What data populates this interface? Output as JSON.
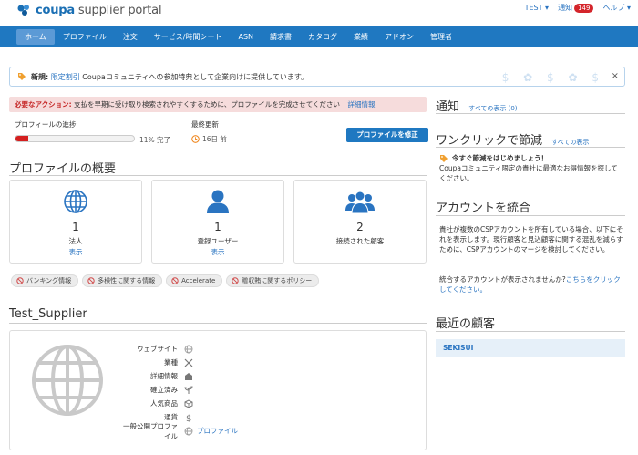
{
  "header": {
    "logo_bold": "coupa",
    "logo_rest": " supplier portal",
    "user": "TEST",
    "notifications_label": "通知",
    "notifications_count": "149",
    "help": "ヘルプ"
  },
  "nav": {
    "items": [
      "ホーム",
      "プロファイル",
      "注文",
      "サービス/時間シート",
      "ASN",
      "請求書",
      "カタログ",
      "業績",
      "アドオン",
      "管理者"
    ]
  },
  "announcement": {
    "prefix": "新規:",
    "link": "限定割引",
    "text": " Coupaコミュニティへの参加特典として企業向けに提供しています。",
    "close": "×"
  },
  "alert": {
    "required": "必要なアクション:",
    "text": " 支払を早期に受け取り検索されやすくするために、プロファイルを完成させてください",
    "link": "詳細情報"
  },
  "profile_progress": {
    "label": "プロフィールの進捗",
    "percent": 11,
    "percent_text": "11% 完了",
    "updated_label": "最終更新",
    "updated_value": "16日 前",
    "button": "プロファイルを修正"
  },
  "overview": {
    "title": "プロファイルの概要",
    "cards": [
      {
        "icon": "globe-icon",
        "count": "1",
        "label": "法人",
        "link": "表示"
      },
      {
        "icon": "user-icon",
        "count": "1",
        "label": "登録ユーザー",
        "link": "表示"
      },
      {
        "icon": "users-icon",
        "count": "2",
        "label": "接続された顧客",
        "link": ""
      }
    ],
    "pills": [
      "バンキング情報",
      "多様性に関する情報",
      "Accelerate",
      "贈収賄に関するポリシー"
    ]
  },
  "supplier": {
    "name": "Test_Supplier",
    "rows": [
      {
        "key": "ウェブサイト",
        "icon": "globe-icon",
        "value": ""
      },
      {
        "key": "業種",
        "icon": "tools-icon",
        "value": ""
      },
      {
        "key": "詳細情報",
        "icon": "building-icon",
        "value": ""
      },
      {
        "key": "確立済み",
        "icon": "seedling-icon",
        "value": ""
      },
      {
        "key": "人気商品",
        "icon": "box-icon",
        "value": ""
      },
      {
        "key": "通貨",
        "icon": "dollar-icon",
        "value": ""
      },
      {
        "key": "一般公開プロファイル",
        "icon": "globe-icon",
        "value": "プロファイル"
      }
    ]
  },
  "right": {
    "notifications_title": "通知",
    "notifications_link": "すべての表示 (0)",
    "savings_title": "ワンクリックで節減",
    "savings_link": "すべての表示",
    "savings_heading": "今すぐ節減をはじめましょう！",
    "savings_text": "Coupaコミュニティ限定の貴社に最適なお得情報を探してください。",
    "merge_title": "アカウントを統合",
    "merge_text": "貴社が複数のCSPアカウントを所有している場合、以下にそれを表示します。現行顧客と見込顧客に関する混乱を減らすために、CSPアカウントのマージを検討してください。",
    "merge_question": "統合するアカウントが表示されませんか?",
    "merge_link": "こちらをクリックしてください。",
    "recent_title": "最近の顧客",
    "recent_customer": "SEKISUI"
  },
  "colors": {
    "brand_blue": "#1f78c1",
    "alert_bg": "#f6dcdc",
    "progress_red": "#d41f1f"
  }
}
